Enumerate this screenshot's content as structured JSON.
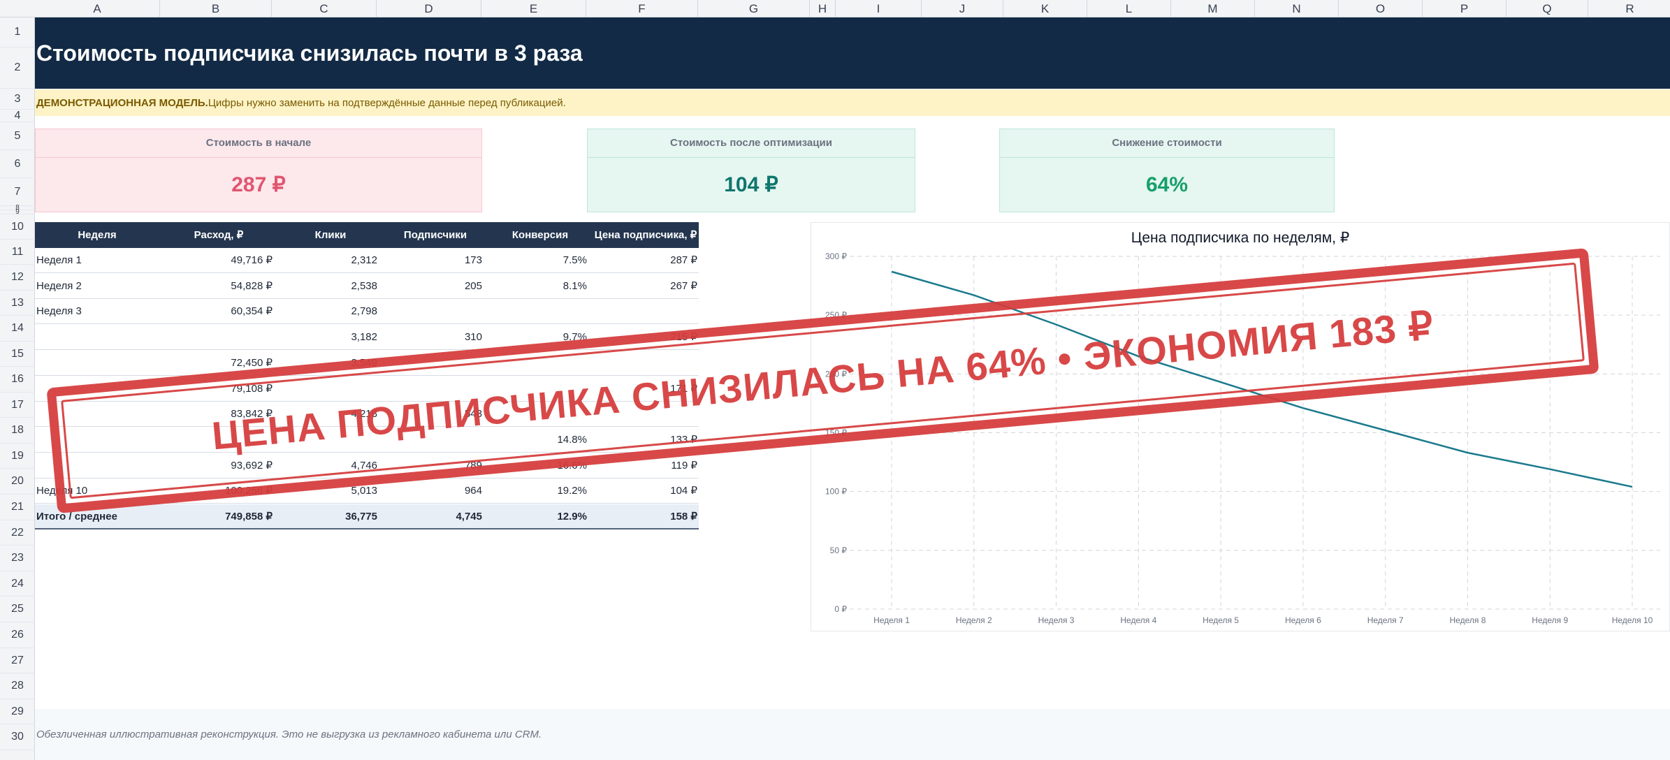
{
  "columns": [
    "A",
    "B",
    "C",
    "D",
    "E",
    "F",
    "G",
    "H",
    "I",
    "J",
    "K",
    "L",
    "M",
    "N",
    "O",
    "P",
    "Q",
    "R"
  ],
  "rows": [
    "1",
    "2",
    "3",
    "4",
    "5",
    "6",
    "7",
    "8",
    "9",
    "10",
    "11",
    "12",
    "13",
    "14",
    "15",
    "16",
    "17",
    "18",
    "19",
    "20",
    "21",
    "22",
    "23",
    "24",
    "25",
    "26",
    "27",
    "28",
    "29",
    "30"
  ],
  "title": "Стоимость подписчика снизилась почти в 3 раза",
  "demo_note": {
    "strong": "ДЕМОНСТРАЦИОННАЯ МОДЕЛЬ.",
    "text": " Цифры нужно заменить на подтверждённые данные перед публикацией."
  },
  "kpis": [
    {
      "label": "Стоимость в начале",
      "value": "287 ₽",
      "color": "#e0566f",
      "bg": "#fde8ec",
      "border": "#f6c9d2"
    },
    {
      "label": "Стоимость после оптимизации",
      "value": "104 ₽",
      "color": "#0f766e",
      "bg": "#e6f6f1",
      "border": "#bfe6dc"
    },
    {
      "label": "Снижение стоимости",
      "value": "64%",
      "color": "#16a06a",
      "bg": "#e6f6f1",
      "border": "#bfe6dc"
    }
  ],
  "table": {
    "headers": [
      "Неделя",
      "Расход, ₽",
      "Клики",
      "Подписчики",
      "Конверсия",
      "Цена подписчика, ₽"
    ],
    "rows": [
      [
        "Неделя 1",
        "49,716 ₽",
        "2,312",
        "173",
        "7.5%",
        "287 ₽"
      ],
      [
        "Неделя 2",
        "54,828 ₽",
        "2,538",
        "205",
        "8.1%",
        "267 ₽"
      ],
      [
        "Неделя 3",
        "60,354 ₽",
        "2,798",
        "",
        "",
        ""
      ],
      [
        "",
        "",
        "3,182",
        "310",
        "9.7%",
        "215 ₽"
      ],
      [
        "",
        "72,450 ₽",
        "3,549",
        "",
        "",
        ""
      ],
      [
        "",
        "79,108 ₽",
        "",
        "",
        "",
        "171 ₽"
      ],
      [
        "",
        "83,842 ₽",
        "4,218",
        "548",
        "",
        ""
      ],
      [
        "",
        "",
        "",
        "",
        "14.8%",
        "133 ₽"
      ],
      [
        "",
        "93,692 ₽",
        "4,746",
        "789",
        "16.6%",
        "119 ₽"
      ],
      [
        "Неделя 10",
        "100,256 ₽",
        "5,013",
        "964",
        "19.2%",
        "104 ₽"
      ]
    ],
    "total": [
      "Итого / среднее",
      "749,858 ₽",
      "36,775",
      "4,745",
      "12.9%",
      "158 ₽"
    ]
  },
  "chart_data": {
    "type": "line",
    "title": "Цена подписчика по неделям, ₽",
    "categories": [
      "Неделя 1",
      "Неделя 2",
      "Неделя 3",
      "Неделя 4",
      "Неделя 5",
      "Неделя 6",
      "Неделя 7",
      "Неделя 8",
      "Неделя 9",
      "Неделя 10"
    ],
    "series": [
      {
        "values": [
          287,
          267,
          242,
          215,
          193,
          171,
          152,
          133,
          119,
          104
        ]
      }
    ],
    "ylim": [
      0,
      300
    ],
    "yticks": [
      0,
      50,
      100,
      150,
      200,
      250,
      300
    ],
    "ytick_labels": [
      "0 ₽",
      "50 ₽",
      "100 ₽",
      "150 ₽",
      "200 ₽",
      "250 ₽",
      "300 ₽"
    ],
    "grid": true,
    "line_color": "#1a7a8c"
  },
  "stamp": "ЦЕНА ПОДПИСЧИКА СНИЗИЛАСЬ НА 64% • ЭКОНОМИЯ 183 ₽",
  "footer": "Обезличенная иллюстративная реконструкция. Это не выгрузка из рекламного кабинета или CRM."
}
